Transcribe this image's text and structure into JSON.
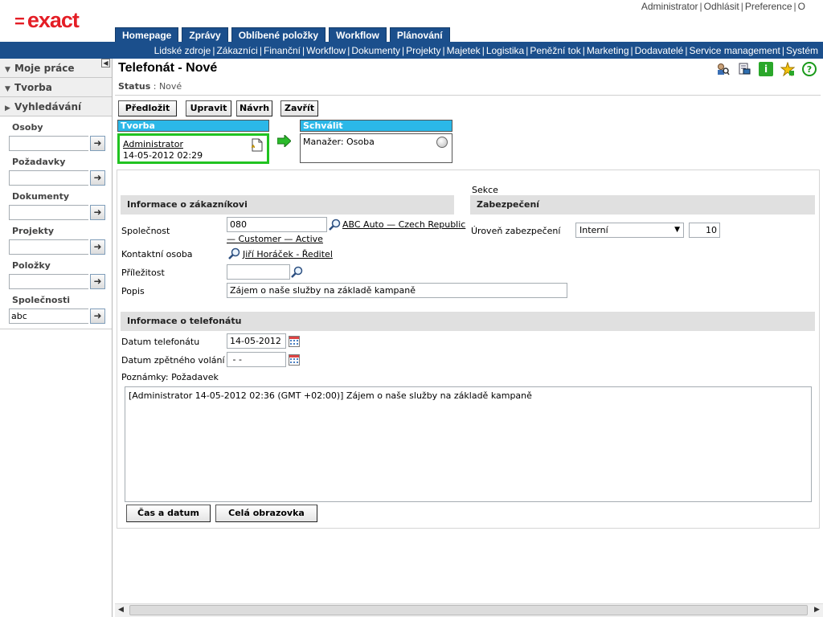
{
  "brand": {
    "logo_text": "exact",
    "logo_color": "#e41e26"
  },
  "top_links": [
    "Administrator",
    "Odhlásit",
    "Preference",
    "O"
  ],
  "tabs": [
    "Homepage",
    "Zprávy",
    "Oblíbené položky",
    "Workflow",
    "Plánování"
  ],
  "nav_links": [
    "Lidské zdroje",
    "Zákazníci",
    "Finanční",
    "Workflow",
    "Dokumenty",
    "Projekty",
    "Majetek",
    "Logistika",
    "Peněžní tok",
    "Marketing",
    "Dodavatelé",
    "Service management",
    "Systém"
  ],
  "sidebar": {
    "moje_prace": "Moje práce",
    "tvorba": "Tvorba",
    "vyhledavani": "Vyhledávání",
    "fields": [
      {
        "label": "Osoby",
        "value": ""
      },
      {
        "label": "Požadavky",
        "value": ""
      },
      {
        "label": "Dokumenty",
        "value": ""
      },
      {
        "label": "Projekty",
        "value": ""
      },
      {
        "label": "Položky",
        "value": ""
      },
      {
        "label": "Společnosti",
        "value": "abc"
      }
    ]
  },
  "page": {
    "title": "Telefonát - Nové",
    "status_label": "Status",
    "status_value": "Nové"
  },
  "toolbar": {
    "predlozit": "Předložit",
    "upravit": "Upravit",
    "navrh": "Návrh",
    "zavrit": "Zavřít"
  },
  "workflow": {
    "step1_title": "Tvorba",
    "step1_user": "Administrator",
    "step1_date": "14-05-2012 02:29",
    "step2_title": "Schválit",
    "step2_text": "Manažer: Osoba"
  },
  "customer": {
    "section_title": "Informace o zákazníkovi",
    "spolecnost_label": "Společnost",
    "spolecnost_value": "080",
    "spolecnost_link_line1": "ABC Auto — Czech Republic",
    "spolecnost_link_line2": "— Customer — Active",
    "kontakt_label": "Kontaktní osoba",
    "kontakt_link": "Jiří Horáček - Ředitel",
    "prilezitost_label": "Příležitost",
    "prilezitost_value": "",
    "popis_label": "Popis",
    "popis_value": "Zájem o naše služby na základě kampaně"
  },
  "security": {
    "sekce_label": "Sekce",
    "section_title": "Zabezpečení",
    "uroven_label": "Úroveň zabezpečení",
    "uroven_value": "Interní",
    "uroven_number": "10"
  },
  "call": {
    "section_title": "Informace o telefonátu",
    "datum_label": "Datum telefonátu",
    "datum_value": "14-05-2012",
    "zpetne_label": "Datum zpětného volání",
    "zpetne_value": " - -",
    "poznamky_label": "Poznámky: Požadavek",
    "poznamky_value": "[Administrator 14-05-2012 02:36 (GMT +02:00)] Zájem o naše služby na základě kampaně"
  },
  "bottom_buttons": {
    "cas": "Čas a datum",
    "cela": "Celá obrazovka"
  }
}
